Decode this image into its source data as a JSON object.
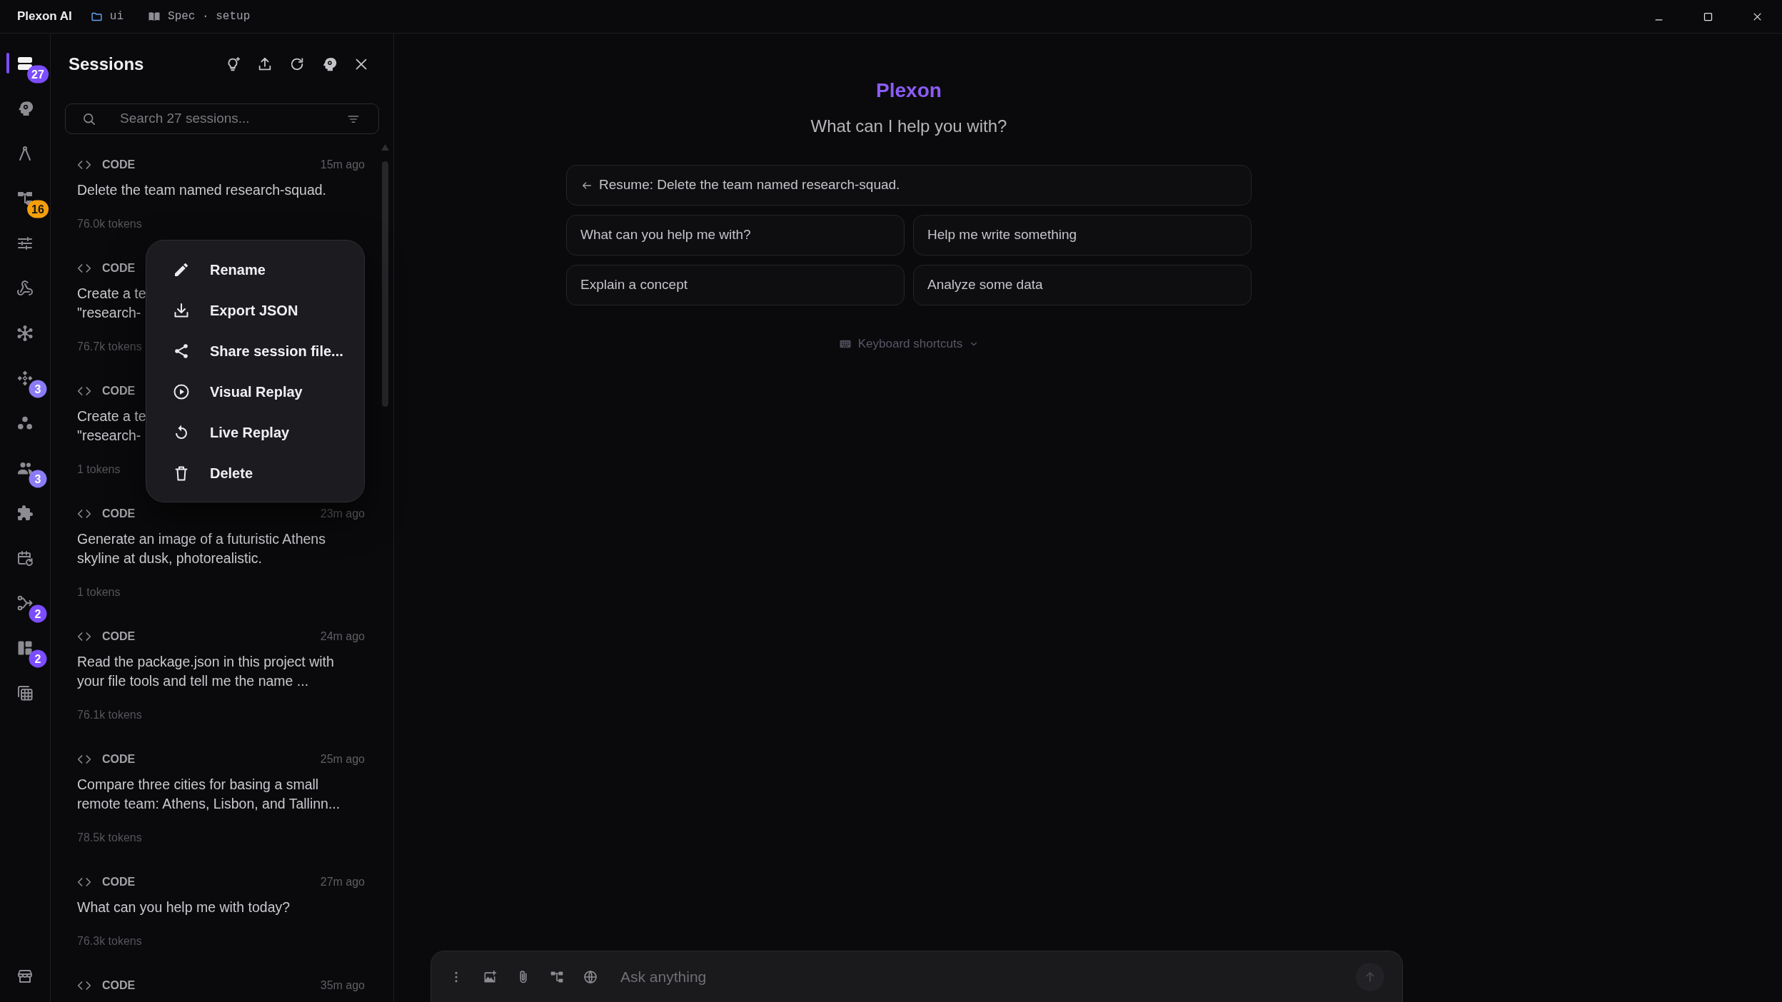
{
  "title_bar": {
    "app_name": "Plexon AI",
    "items": [
      {
        "kind": "folder",
        "label": "ui"
      },
      {
        "kind": "book",
        "label": "Spec · setup"
      }
    ]
  },
  "rail": {
    "items": [
      {
        "selected": true,
        "badge": "27",
        "color": "#7c4dff"
      },
      {
        "selected": false
      },
      {
        "selected": false
      },
      {
        "selected": false,
        "badge": "16",
        "color": "#f59e0b"
      },
      {
        "selected": false
      },
      {
        "selected": false
      },
      {
        "selected": false
      },
      {
        "selected": false,
        "badge": "3",
        "color": "#8b7cf6"
      },
      {
        "selected": false
      },
      {
        "selected": false,
        "badge": "3",
        "color": "#8b7cf6"
      },
      {
        "selected": false
      },
      {
        "selected": false
      },
      {
        "selected": false,
        "badge": "2",
        "color": "#7c4dff"
      },
      {
        "selected": false,
        "badge": "2",
        "color": "#7c4dff"
      },
      {
        "selected": false
      }
    ]
  },
  "sessions_panel": {
    "title": "Sessions",
    "search": {
      "placeholder": "Search 27 sessions..."
    },
    "sessions": [
      {
        "type": "CODE",
        "time": "15m ago",
        "text": "Delete the team named research-squad.",
        "tokens": "76.0k tokens"
      },
      {
        "type": "CODE",
        "lines": [
          "Create a te",
          "\"research-"
        ],
        "tokens": "76.7k tokens"
      },
      {
        "type": "CODE",
        "lines": [
          "Create a te",
          "\"research-"
        ],
        "tokens": "1 tokens"
      },
      {
        "type": "CODE",
        "time": "23m ago",
        "text": "Generate an image of a futuristic Athens skyline at dusk, photorealistic.",
        "tokens": "1 tokens"
      },
      {
        "type": "CODE",
        "time": "24m ago",
        "text": "Read the package.json in this project with your file tools and tell me the name ...",
        "tokens": "76.1k tokens"
      },
      {
        "type": "CODE",
        "time": "25m ago",
        "text": "Compare three cities for basing a small remote team: Athens, Lisbon, and Tallinn...",
        "tokens": "78.5k tokens"
      },
      {
        "type": "CODE",
        "time": "27m ago",
        "text": "What can you help me with today?",
        "tokens": "76.3k tokens"
      },
      {
        "type": "CODE",
        "time": "35m ago"
      }
    ]
  },
  "context_menu": {
    "items": [
      "Rename",
      "Export JSON",
      "Share session file...",
      "Visual Replay",
      "Live Replay",
      "Delete"
    ]
  },
  "main": {
    "brand": "Plexon",
    "subtitle": "What can I help you with?",
    "resume": "Resume: Delete the team named research-squad.",
    "suggestions": [
      "What can you help me with?",
      "Help me write something",
      "Explain a concept",
      "Analyze some data"
    ],
    "shortcuts_toggle": "Keyboard shortcuts"
  },
  "composer": {
    "placeholder": "Ask anything"
  }
}
